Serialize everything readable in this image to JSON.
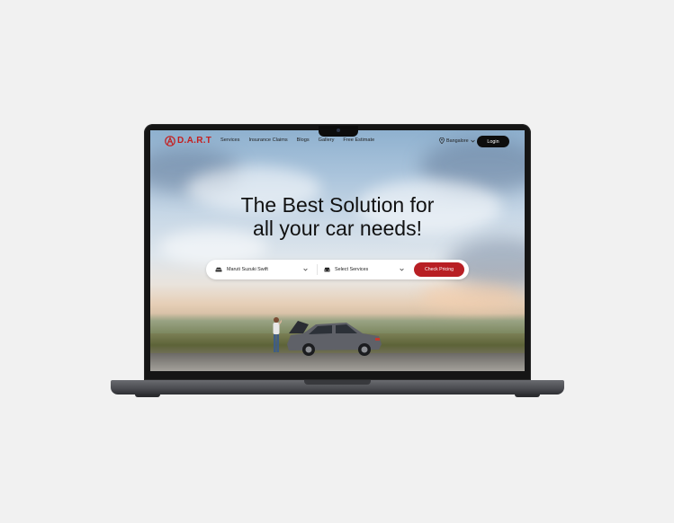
{
  "brand": {
    "logo_text": "D.A.R.T",
    "accent_color": "#b81f24"
  },
  "nav": {
    "links": [
      {
        "label": "Services"
      },
      {
        "label": "Insurance Claims"
      },
      {
        "label": "Blogs"
      },
      {
        "label": "Gallery"
      },
      {
        "label": "Free Estimate"
      }
    ],
    "location": "Bangalore",
    "login_label": "Login"
  },
  "hero": {
    "title_line1": "The Best Solution for",
    "title_line2": "all your car needs!"
  },
  "search": {
    "car_value": "Maruti Suzuki Swift",
    "service_placeholder": "Select Services",
    "button_label": "Check Pricing"
  },
  "icons": {
    "location": "location-pin-icon",
    "car": "car-icon",
    "service": "car-front-icon",
    "chevron": "chevron-down-icon"
  }
}
